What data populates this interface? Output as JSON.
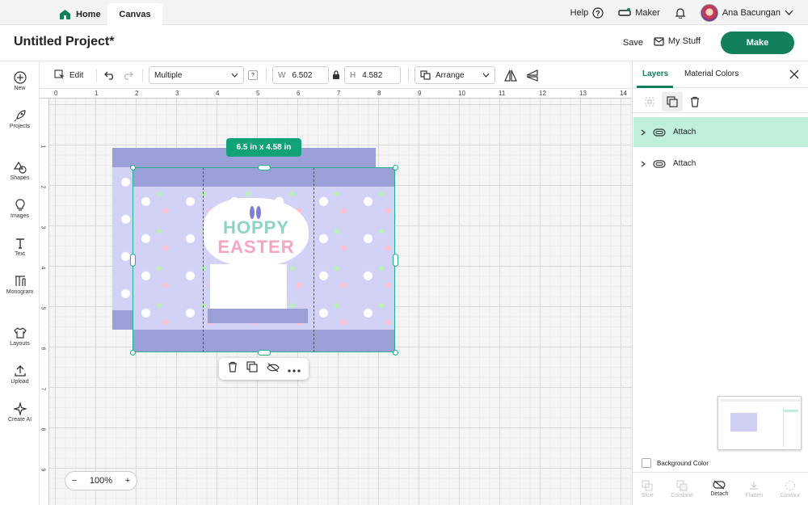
{
  "topbar": {
    "home_tab": "Home",
    "canvas_tab": "Canvas",
    "help": "Help",
    "machine": "Maker",
    "user_name": "Ana Bacungan"
  },
  "titlebar": {
    "project_title": "Untitled Project*",
    "save": "Save",
    "my_stuff": "My Stuff",
    "make": "Make"
  },
  "leftbar": {
    "items": [
      "New",
      "Projects",
      "Shapes",
      "Images",
      "Text",
      "Monogram",
      "Layouts",
      "Upload",
      "Create AI"
    ]
  },
  "edit_toolbar": {
    "edit": "Edit",
    "operation": "Multiple",
    "help_badge": "?",
    "width_label": "W",
    "width_value": "6.502",
    "height_label": "H",
    "height_value": "4.582",
    "arrange": "Arrange"
  },
  "rulers": {
    "top": [
      "0",
      "1",
      "2",
      "3",
      "4",
      "5",
      "6",
      "7",
      "8",
      "9",
      "10",
      "11",
      "12",
      "13",
      "14"
    ],
    "left": [
      "1",
      "2",
      "3",
      "4",
      "5",
      "6",
      "7",
      "8",
      "9"
    ]
  },
  "canvas": {
    "dimension_tag": "6.5  in x 4.58  in",
    "design_text_1": "HOPPY",
    "design_text_2": "EASTER",
    "zoom": "100%",
    "zoom_minus": "−",
    "zoom_plus": "+"
  },
  "right_panel": {
    "tabs": [
      "Layers",
      "Material Colors"
    ],
    "layers": [
      {
        "label": "Attach",
        "selected": true
      },
      {
        "label": "Attach",
        "selected": false
      }
    ],
    "background_color": "Background Color",
    "bottom_tools": [
      {
        "label": "Slice",
        "enabled": false
      },
      {
        "label": "Combine",
        "enabled": false
      },
      {
        "label": "Detach",
        "enabled": true
      },
      {
        "label": "Flatten",
        "enabled": false
      },
      {
        "label": "Contour",
        "enabled": false
      }
    ]
  },
  "colors": {
    "brand_green": "#12805c",
    "selection_green": "#1fb28b",
    "layer_selected": "#bfeedb",
    "pattern_lavender": "#d2d1f6",
    "band_purple": "#9ba0d8"
  }
}
